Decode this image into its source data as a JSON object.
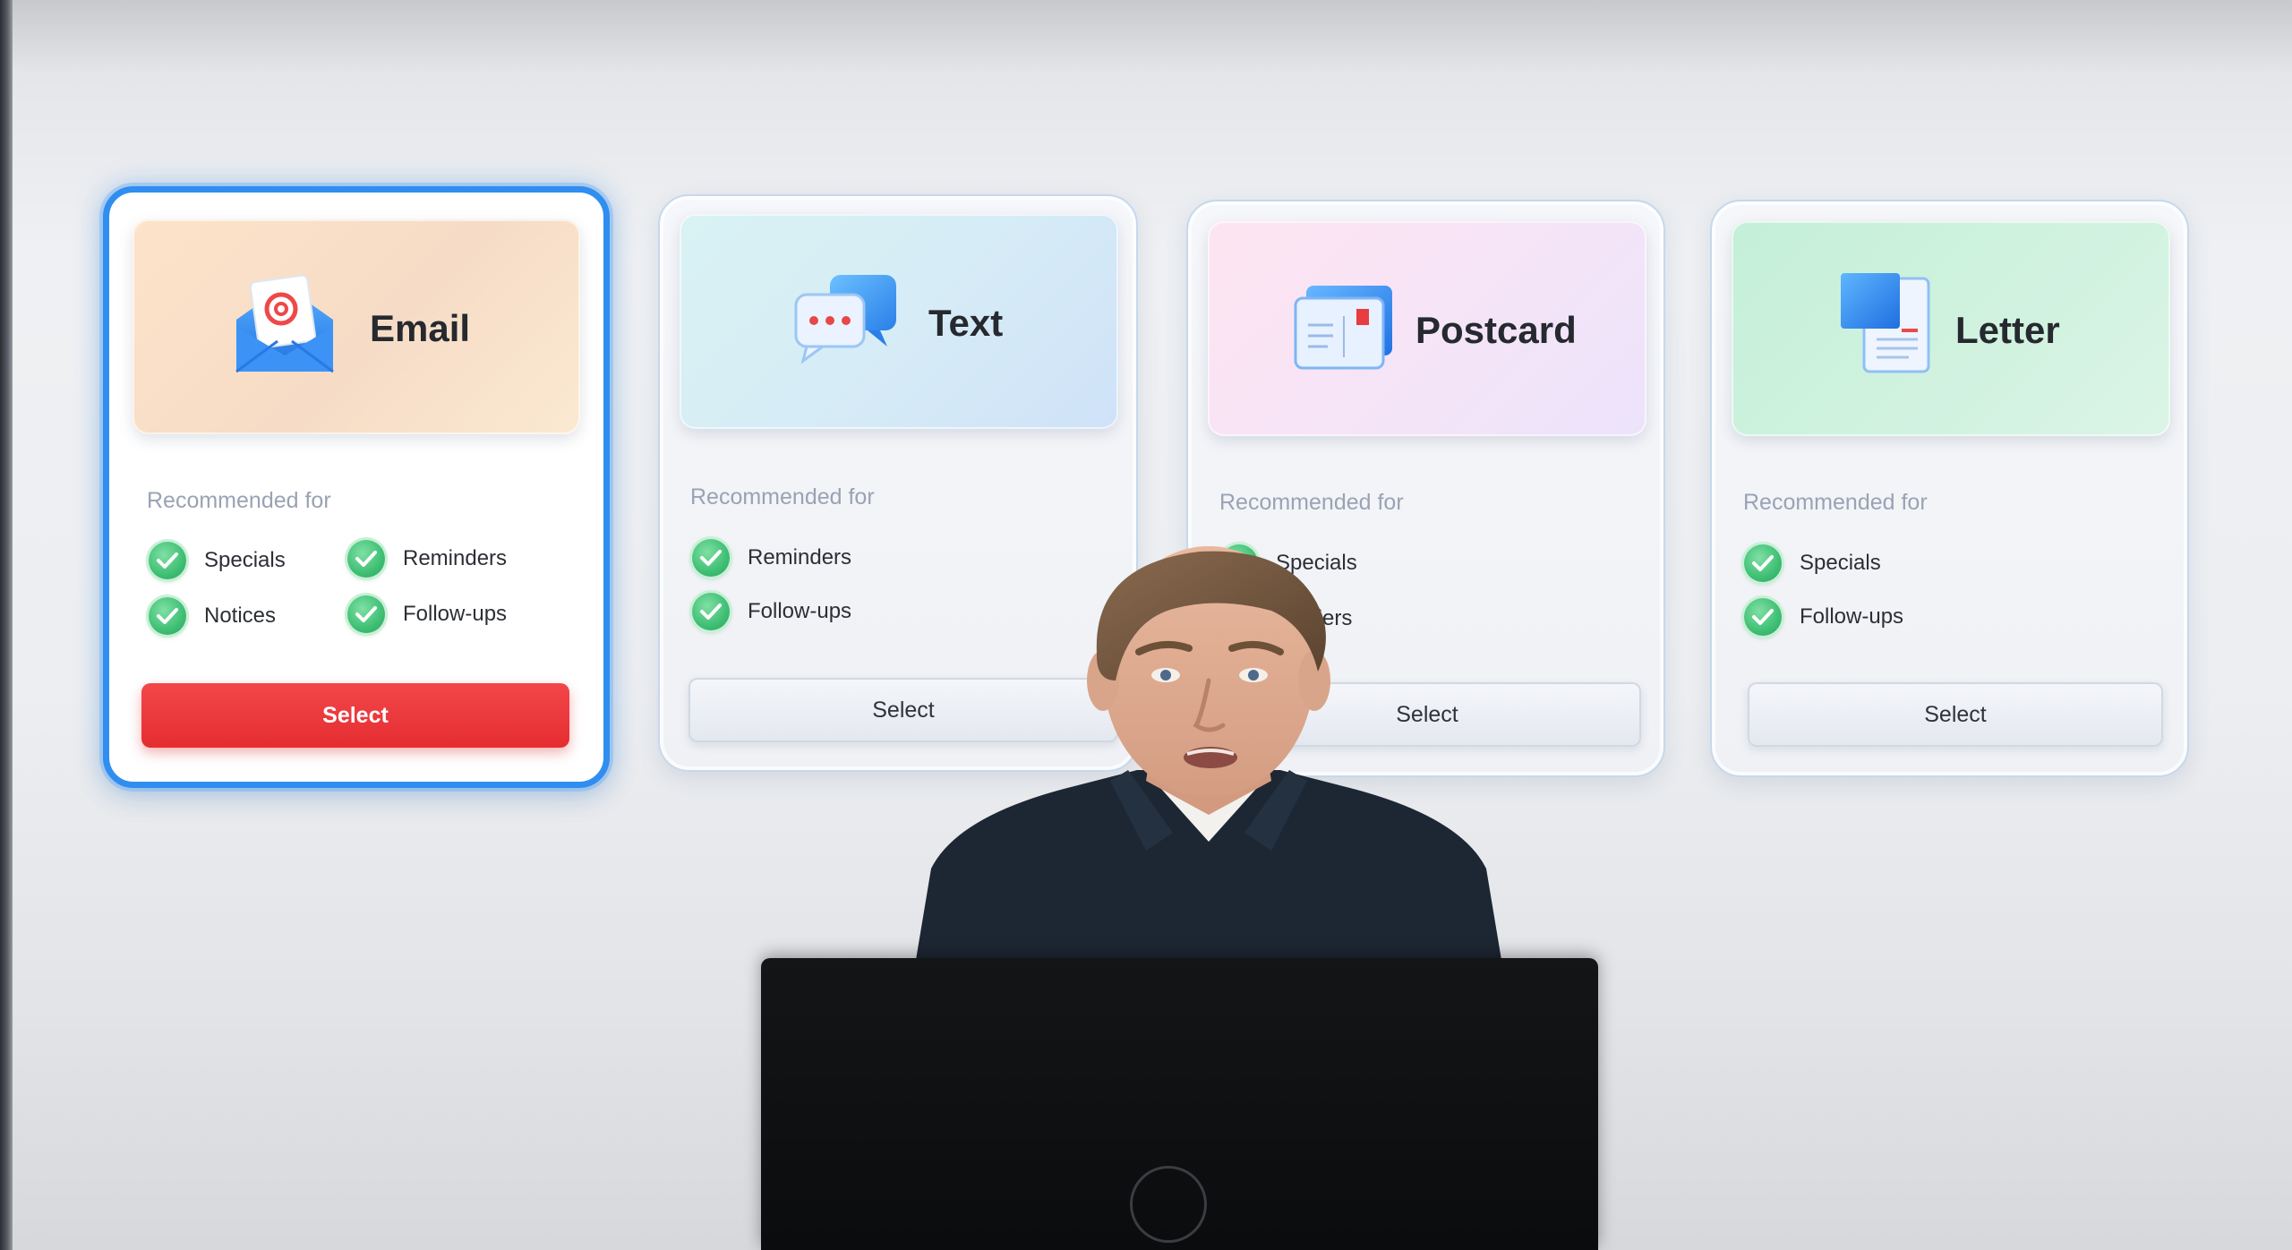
{
  "cards": [
    {
      "title": "Email",
      "icon": "email-envelope-icon",
      "recommended_label": "Recommended for",
      "features": [
        "Specials",
        "Reminders",
        "Notices",
        "Follow-ups"
      ],
      "select_label": "Select",
      "selected": true,
      "header_colors": [
        "#fde7cf",
        "#f3d8c4"
      ]
    },
    {
      "title": "Text",
      "icon": "text-message-icon",
      "recommended_label": "Recommended for",
      "features": [
        "Reminders",
        "Follow-ups"
      ],
      "select_label": "Select",
      "selected": false,
      "header_colors": [
        "#d8f0f5",
        "#cfe3f7"
      ]
    },
    {
      "title": "Postcard",
      "icon": "postcard-icon",
      "recommended_label": "Recommended for",
      "features": [
        "Specials",
        "Reminders"
      ],
      "visible_features": [
        "Specials",
        "minders"
      ],
      "select_label": "Select",
      "selected": false,
      "header_colors": [
        "#fbe6f3",
        "#efe3fb"
      ]
    },
    {
      "title": "Letter",
      "icon": "letter-document-icon",
      "recommended_label": "Recommended for",
      "features": [
        "Specials",
        "Follow-ups"
      ],
      "select_label": "Select",
      "selected": false,
      "header_colors": [
        "#c8f0da",
        "#d6f3e2"
      ]
    }
  ],
  "colors": {
    "selected_border": "#2f8ef0",
    "primary_button": "#e83236",
    "check_green": "#3fbf74"
  }
}
